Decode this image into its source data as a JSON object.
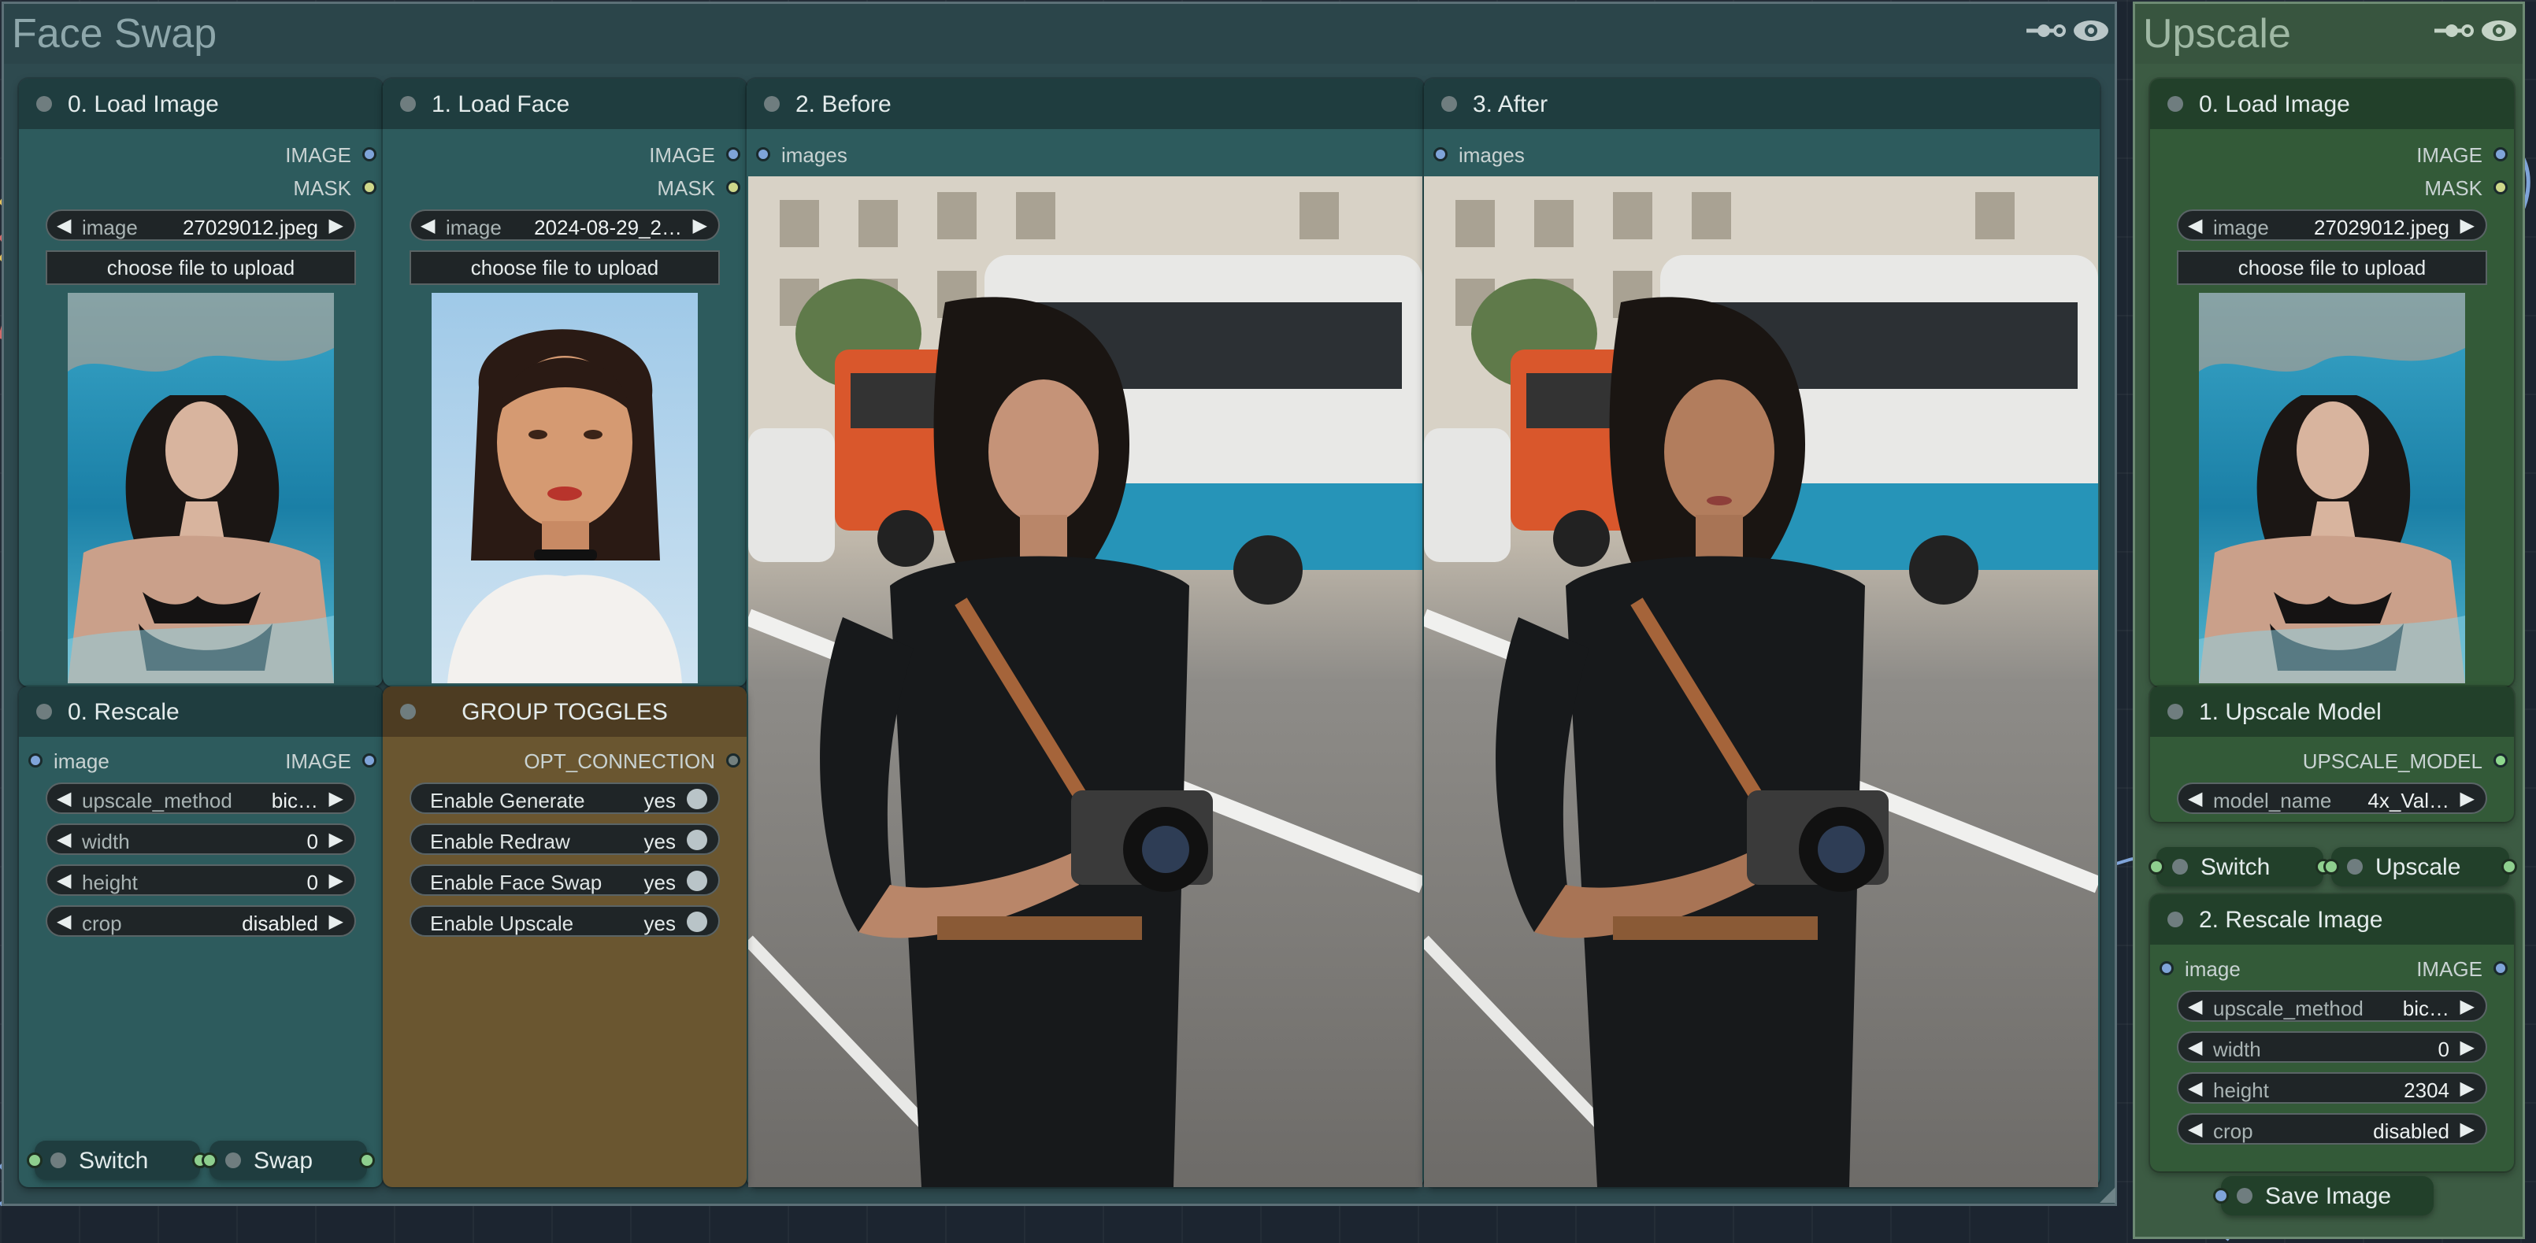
{
  "colors": {
    "canvas_bg": "#1c2530",
    "face_swap_group": "#2e4a4f",
    "upscale_group": "#3c5b43",
    "node_teal": "#2d5b5d",
    "node_green": "#335a38",
    "node_brown": "#6a5630",
    "pin_image": "#7fa4d9",
    "pin_mask": "#cfd88a",
    "pin_model": "#8ed88e"
  },
  "groups": {
    "face_swap": {
      "title": "Face Swap",
      "icons": [
        "connection-icon",
        "eye-icon"
      ]
    },
    "upscale": {
      "title": "Upscale",
      "icons": [
        "connection-icon",
        "eye-icon"
      ]
    }
  },
  "face_swap": {
    "load_image": {
      "title": "0. Load Image",
      "outputs": [
        "IMAGE",
        "MASK"
      ],
      "image_label": "image",
      "image_value": "27029012.jpeg",
      "upload_label": "choose file to upload"
    },
    "load_face": {
      "title": "1. Load Face",
      "outputs": [
        "IMAGE",
        "MASK"
      ],
      "image_label": "image",
      "image_value": "2024-08-29_2…",
      "upload_label": "choose file to upload"
    },
    "before": {
      "title": "2. Before",
      "input": "images"
    },
    "after": {
      "title": "3. After",
      "input": "images"
    },
    "rescale": {
      "title": "0. Rescale",
      "input": "image",
      "output": "IMAGE",
      "widgets": [
        {
          "label": "upscale_method",
          "value": "bic…"
        },
        {
          "label": "width",
          "value": "0"
        },
        {
          "label": "height",
          "value": "0"
        },
        {
          "label": "crop",
          "value": "disabled"
        }
      ]
    },
    "group_toggles": {
      "title": "GROUP TOGGLES",
      "output": "OPT_CONNECTION",
      "toggles": [
        {
          "label": "Enable Generate",
          "value": "yes"
        },
        {
          "label": "Enable Redraw",
          "value": "yes"
        },
        {
          "label": "Enable Face Swap",
          "value": "yes"
        },
        {
          "label": "Enable Upscale",
          "value": "yes"
        }
      ]
    },
    "switch_node": {
      "label": "Switch"
    },
    "swap_node": {
      "label": "Swap"
    }
  },
  "upscale": {
    "load_image": {
      "title": "0. Load Image",
      "outputs": [
        "IMAGE",
        "MASK"
      ],
      "image_label": "image",
      "image_value": "27029012.jpeg",
      "upload_label": "choose file to upload"
    },
    "upscale_model": {
      "title": "1. Upscale Model",
      "output": "UPSCALE_MODEL",
      "widget_label": "model_name",
      "widget_value": "4x_Val…"
    },
    "switch_node": {
      "label": "Switch"
    },
    "upscale_node": {
      "label": "Upscale"
    },
    "rescale_image": {
      "title": "2. Rescale Image",
      "input": "image",
      "output": "IMAGE",
      "widgets": [
        {
          "label": "upscale_method",
          "value": "bic…"
        },
        {
          "label": "width",
          "value": "0"
        },
        {
          "label": "height",
          "value": "2304"
        },
        {
          "label": "crop",
          "value": "disabled"
        }
      ]
    },
    "save_image": {
      "label": "Save Image"
    }
  }
}
